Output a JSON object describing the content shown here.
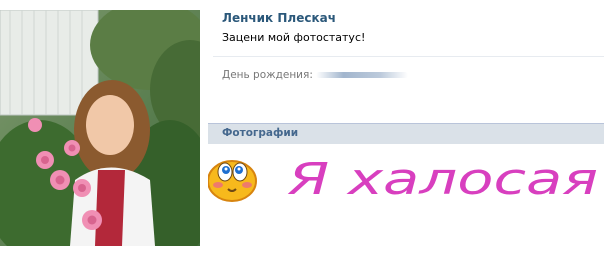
{
  "profile": {
    "name": "Ленчик Плескач",
    "status": "Зацени мой фотостатус!",
    "birthday_label": "День рождения:",
    "avatar_icon": "profile-photo"
  },
  "photos": {
    "section_title": "Фотографии",
    "banner_text": "Я халосая",
    "banner_color": "#d83fbf"
  }
}
